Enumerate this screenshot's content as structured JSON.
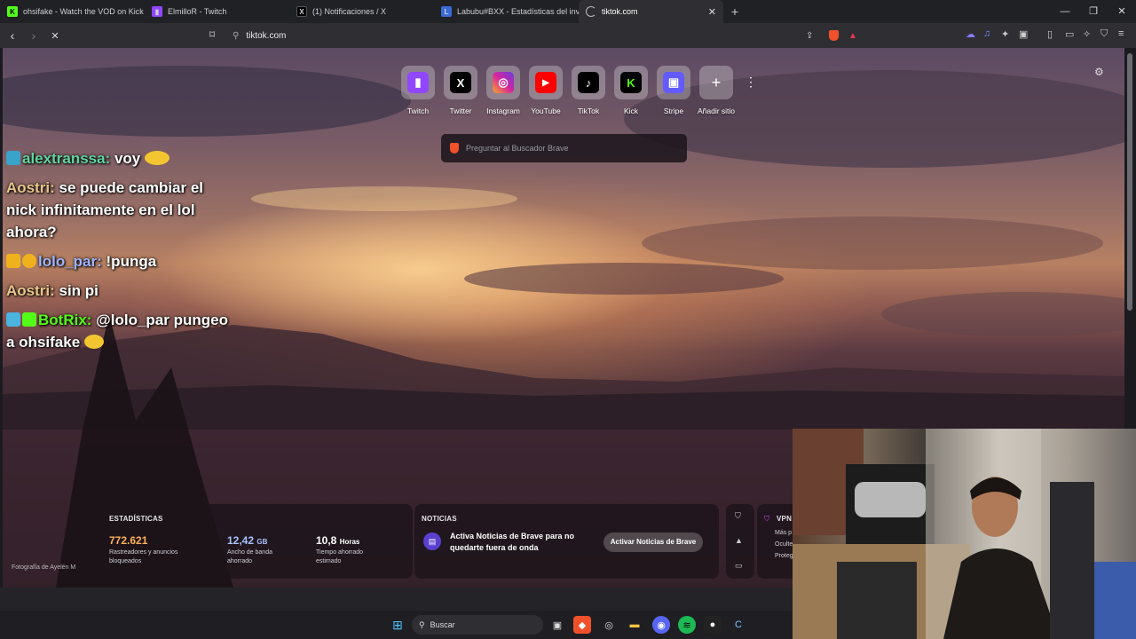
{
  "tabs": [
    {
      "title": "ohsifake - Watch the VOD on Kick",
      "color": "#53fc18",
      "glyph": "K"
    },
    {
      "title": "ElmilloR - Twitch",
      "color": "#9146ff",
      "glyph": "▮"
    },
    {
      "title": "(1) Notificaciones / X",
      "color": "#000000",
      "glyph": "X"
    },
    {
      "title": "Labubu#BXX - Estadísticas del invoca",
      "color": "#3b6bd6",
      "glyph": "L"
    },
    {
      "title": "tiktok.com",
      "color": "#2f2f33",
      "glyph": "◌"
    }
  ],
  "toolbar": {
    "url": "tiktok.com"
  },
  "top_sites": [
    {
      "label": "Twitch",
      "bg": "#9146ff",
      "glyph": "▮",
      "fg": "#fff"
    },
    {
      "label": "Twitter",
      "bg": "#000000",
      "glyph": "X",
      "fg": "#fff"
    },
    {
      "label": "Instagram",
      "bg": "#d6249f",
      "glyph": "◎",
      "fg": "#fff"
    },
    {
      "label": "YouTube",
      "bg": "#ff0000",
      "glyph": "▶",
      "fg": "#fff"
    },
    {
      "label": "TikTok",
      "bg": "#000000",
      "glyph": "♪",
      "fg": "#fff"
    },
    {
      "label": "Kick",
      "bg": "#000000",
      "glyph": "K",
      "fg": "#53fc18"
    },
    {
      "label": "Stripe",
      "bg": "#635bff",
      "glyph": "▣",
      "fg": "#fff"
    },
    {
      "label": "Añadir sitio",
      "bg": "transparent",
      "glyph": "+",
      "fg": "#fff"
    }
  ],
  "search": {
    "placeholder": "Preguntar al Buscador Brave"
  },
  "chat": [
    {
      "user": "alextranssa:",
      "user_color": "#5fd6a0",
      "text": " voy",
      "badge": "#3aa3c9"
    },
    {
      "user": "Aostri:",
      "user_color": "#e8c68a",
      "text": " se puede cambiar el nick infinitamente en el lol ahora?",
      "badge": ""
    },
    {
      "user": "lolo_par:",
      "user_color": "#9fb5ff",
      "text": " !punga",
      "badge": "#f0b21c"
    },
    {
      "user": "Aostri:",
      "user_color": "#e8c68a",
      "text": " sin pi",
      "badge": ""
    },
    {
      "user": "BotRix:",
      "user_color": "#53fc18",
      "text": " @lolo_par pungeo a ohsifake",
      "badge": "#4ab3e0"
    }
  ],
  "stats": {
    "title": "ESTADÍSTICAS",
    "trackers_value": "772.621",
    "trackers_label": "Rastreadores y anuncios bloqueados",
    "bandwidth_value": "12,42",
    "bandwidth_unit": "GB",
    "bandwidth_label": "Ancho de banda ahorrado",
    "time_value": "10,8",
    "time_unit": "Horas",
    "time_label": "Tiempo ahorrado estimado"
  },
  "news": {
    "title": "NOTICIAS",
    "text": "Activa Noticias de Brave para no quedarte fuera de onda",
    "button": "Activar Noticias de Brave"
  },
  "vpn": {
    "title": "VPN",
    "items": [
      "Más p",
      "Oculte",
      "Proteg"
    ]
  },
  "photo_credit": "Fotografía de Ayelén M",
  "taskbar": {
    "search": "Buscar"
  },
  "colors": {
    "brave_orange": "#f0512b",
    "stat_orange": "#ffb35c",
    "stat_blue": "#a8c3ff"
  }
}
